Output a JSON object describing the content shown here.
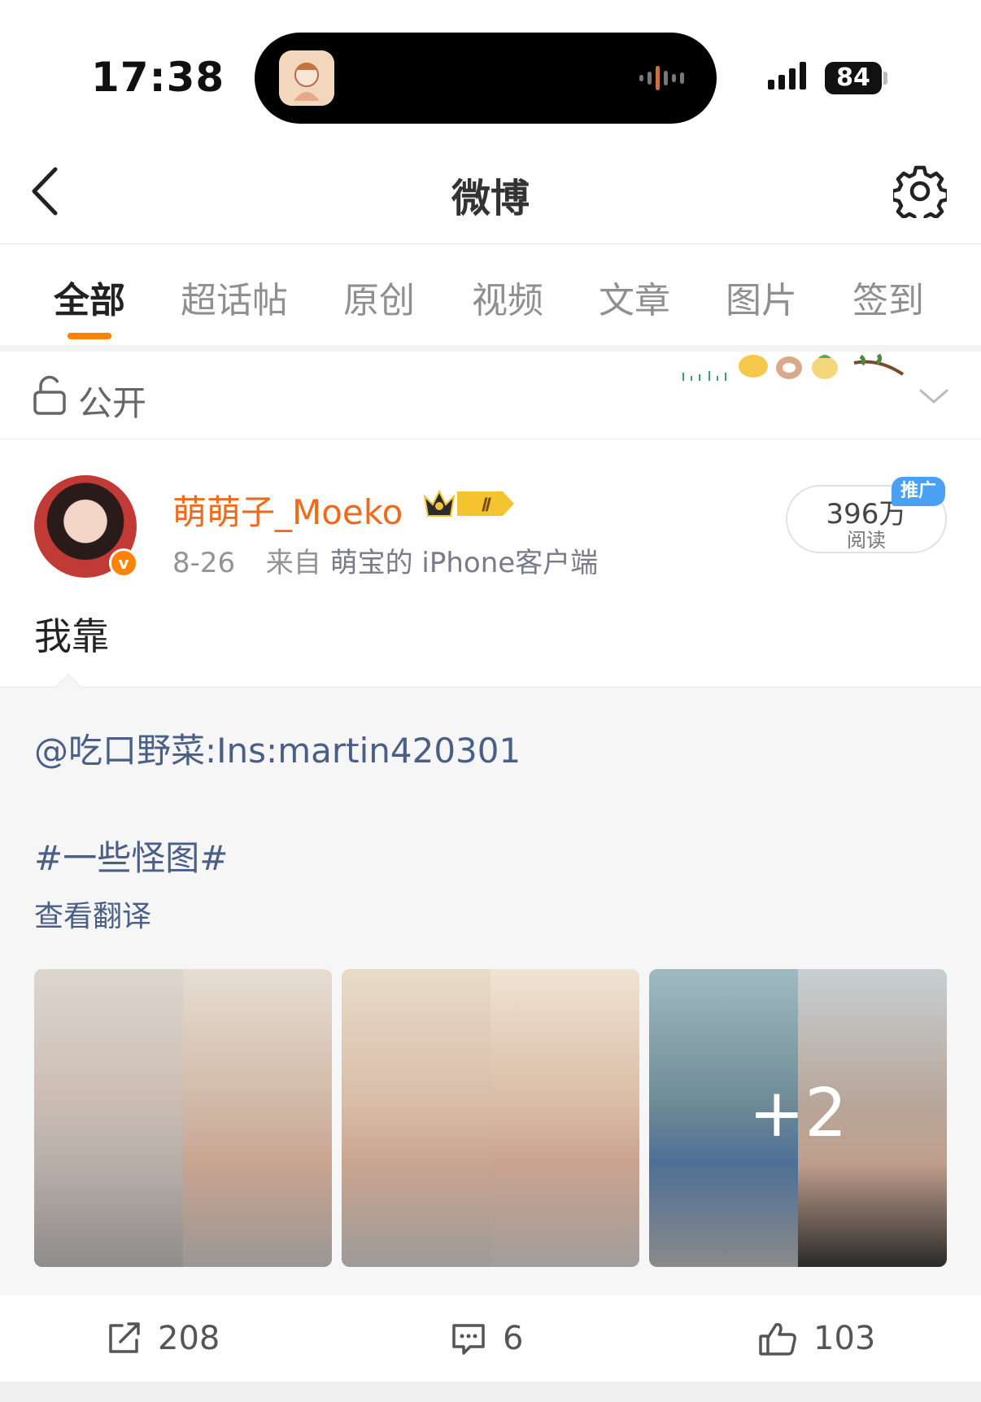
{
  "status_bar": {
    "time": "17:38",
    "battery": "84"
  },
  "nav": {
    "title": "微博",
    "back_icon": "chevron-left-icon",
    "settings_icon": "gear-icon"
  },
  "tabs": [
    {
      "label": "全部",
      "active": true
    },
    {
      "label": "超话帖",
      "active": false
    },
    {
      "label": "原创",
      "active": false
    },
    {
      "label": "视频",
      "active": false
    },
    {
      "label": "文章",
      "active": false
    },
    {
      "label": "图片",
      "active": false
    },
    {
      "label": "签到",
      "active": false
    }
  ],
  "visibility": {
    "label": "公开",
    "icon": "lock-icon"
  },
  "post": {
    "username": "萌萌子_Moeko",
    "crown_level": "Ⅱ",
    "date": "8-26",
    "source_prefix": "来自",
    "source": "萌宝的 iPhone客户端",
    "reads_count": "396万",
    "reads_label": "阅读",
    "promo_tag": "推广",
    "text": "我靠",
    "verified_mark": "v"
  },
  "repost": {
    "mention": "@吃口野菜",
    "body": ":Ins:martin420301",
    "topic": "#一些怪图#",
    "translate_link": "查看翻译",
    "more_images": "+2"
  },
  "actions": {
    "share_count": "208",
    "comment_count": "6",
    "like_count": "103"
  },
  "colors": {
    "accent_orange": "#ff8200",
    "username_orange": "#f06a1c",
    "link_blue": "#4a5f86",
    "promo_blue": "#4aa0f3"
  }
}
